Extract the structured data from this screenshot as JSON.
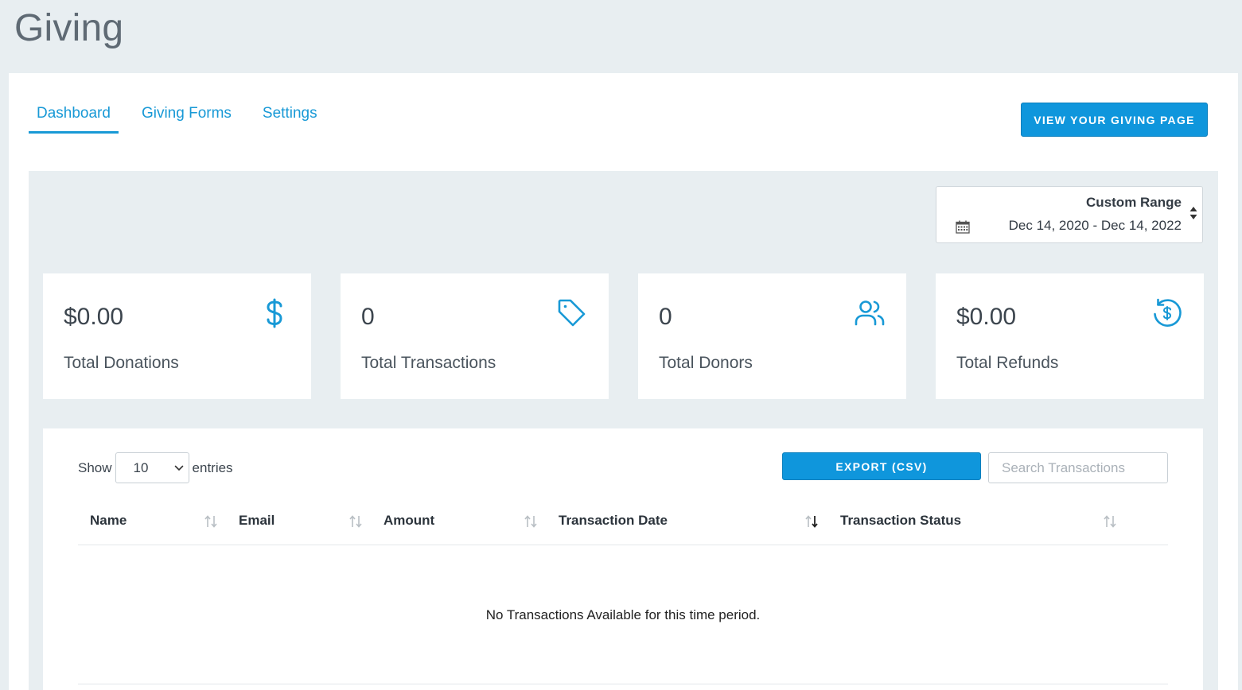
{
  "page": {
    "title": "Giving"
  },
  "tabs": [
    {
      "label": "Dashboard",
      "active": true
    },
    {
      "label": "Giving Forms",
      "active": false
    },
    {
      "label": "Settings",
      "active": false
    }
  ],
  "header": {
    "view_page_button": "VIEW YOUR GIVING PAGE"
  },
  "date_range": {
    "label": "Custom Range",
    "value": "Dec 14, 2020 - Dec 14, 2022",
    "icon": "calendar-icon"
  },
  "stats": [
    {
      "value": "$0.00",
      "label": "Total Donations",
      "icon": "dollar-icon"
    },
    {
      "value": "0",
      "label": "Total Transactions",
      "icon": "tag-icon"
    },
    {
      "value": "0",
      "label": "Total Donors",
      "icon": "users-icon"
    },
    {
      "value": "$0.00",
      "label": "Total Refunds",
      "icon": "refund-icon"
    }
  ],
  "table": {
    "show_label": "Show",
    "entries_value": "10",
    "entries_label": "entries",
    "export_button": "EXPORT (CSV)",
    "search_placeholder": "Search Transactions",
    "columns": [
      "Name",
      "Email",
      "Amount",
      "Transaction Date",
      "Transaction Status"
    ],
    "sorted_column": "Transaction Date",
    "empty_message": "No Transactions Available for this time period."
  },
  "colors": {
    "accent": "#1899d6",
    "button": "#0f96dc",
    "background": "#e8eef1"
  }
}
